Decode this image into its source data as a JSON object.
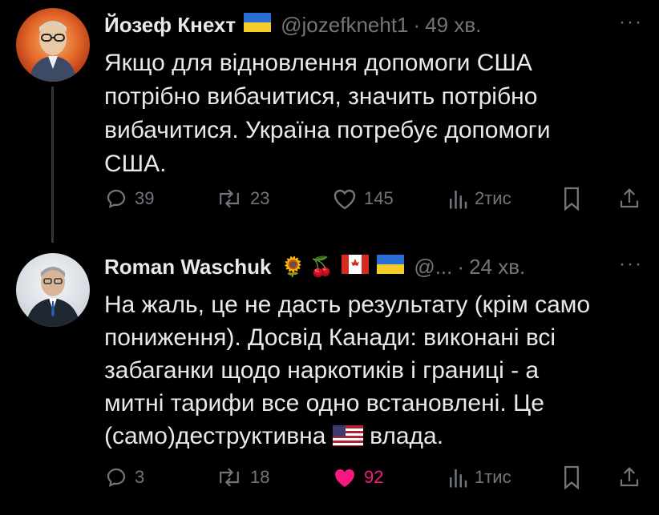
{
  "tweets": [
    {
      "author_name": "Йозеф Кнехт",
      "flag": "ukraine-flag",
      "handle": "@jozefkneht1",
      "time": "49 хв.",
      "text": "Якщо для відновлення допомоги США\nпотрібно вибачитися, значить потрібно\nвибачитися. Україна потребує допомоги\nСША.",
      "replies": "39",
      "reposts": "23",
      "likes": "145",
      "views": "2тис",
      "liked": false
    },
    {
      "author_name": "Roman Waschuk",
      "emoji": [
        "🌻",
        "🍒"
      ],
      "flags": [
        "canada-flag",
        "ukraine-flag"
      ],
      "handle": "@...",
      "time": "24 хв.",
      "text_before_flag": "На жаль, це не дасть результату (крім само\nпониження). Досвід Канади: виконані всі\nзабаганки щодо наркотиків і границі - а\nмитні тарифи все одно встановлені. Це\n(само)деструктивна ",
      "inline_flag": "us-flag",
      "text_after_flag": " влада.",
      "replies": "3",
      "reposts": "18",
      "likes": "92",
      "views": "1тис",
      "liked": true
    }
  ],
  "colors": {
    "background": "#000000",
    "text": "#e7e9ea",
    "muted": "#71767b",
    "like_active": "#f91880"
  },
  "more_label": "···",
  "dot": "·"
}
